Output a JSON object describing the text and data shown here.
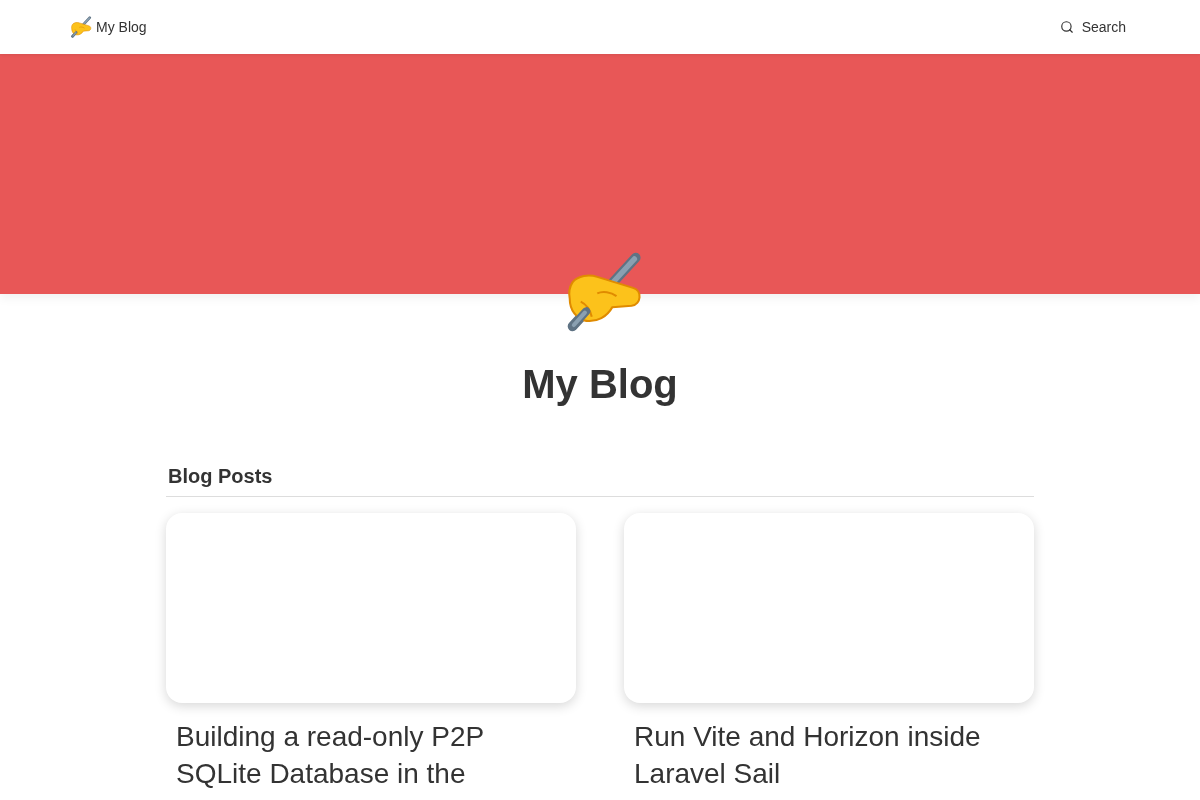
{
  "header": {
    "brand": {
      "label": "My Blog"
    },
    "search": {
      "label": "Search"
    }
  },
  "hero": {
    "title": "My Blog"
  },
  "posts_section": {
    "heading": "Blog Posts",
    "posts": [
      {
        "title": "Building a read-only P2P SQLite Database in the"
      },
      {
        "title": "Run Vite and Horizon inside Laravel Sail"
      }
    ]
  }
}
